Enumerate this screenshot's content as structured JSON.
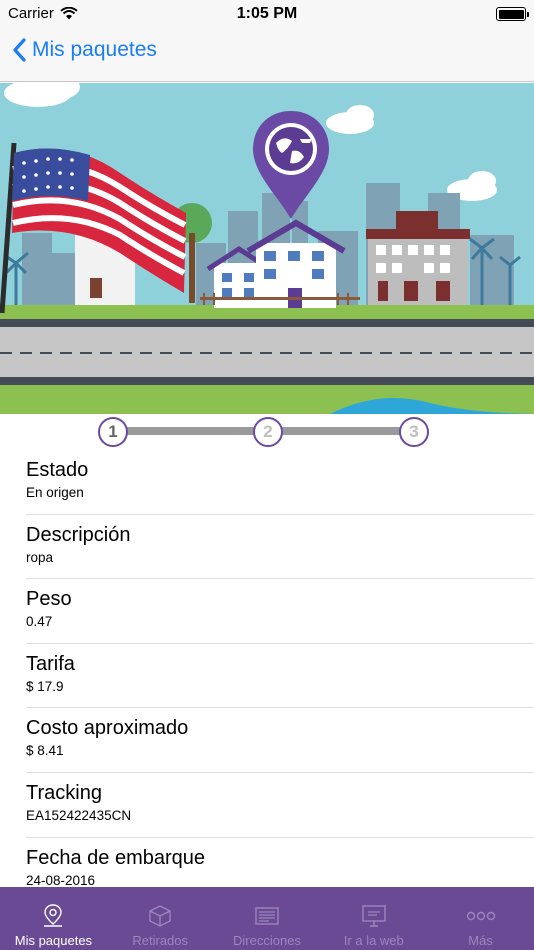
{
  "status_bar": {
    "carrier": "Carrier",
    "time": "1:05 PM"
  },
  "nav": {
    "back_label": "Mis paquetes"
  },
  "banner": {
    "marker_icon": "globe-logo-pin"
  },
  "progress": {
    "steps": [
      "1",
      "2",
      "3"
    ],
    "current_step": 1
  },
  "details": [
    {
      "label": "Estado",
      "value": "En origen"
    },
    {
      "label": "Descripción",
      "value": "ropa"
    },
    {
      "label": "Peso",
      "value": "0.47"
    },
    {
      "label": "Tarifa",
      "value": "$ 17.9"
    },
    {
      "label": "Costo aproximado",
      "value": "$ 8.41"
    },
    {
      "label": "Tracking",
      "value": "EA152422435CN"
    },
    {
      "label": "Fecha de embarque",
      "value": "24-08-2016"
    }
  ],
  "tabs": [
    {
      "label": "Mis paquetes",
      "icon": "location-pin-icon",
      "active": true
    },
    {
      "label": "Retirados",
      "icon": "box-icon",
      "active": false
    },
    {
      "label": "Direcciones",
      "icon": "address-card-icon",
      "active": false
    },
    {
      "label": "Ir a la web",
      "icon": "monitor-icon",
      "active": false
    },
    {
      "label": "Más",
      "icon": "more-dots-icon",
      "active": false
    }
  ],
  "colors": {
    "accent": "#1a7df4",
    "tab_bar": "#6a4a95",
    "sky": "#8ed1da",
    "brand_purple": "#6a4aa5"
  }
}
